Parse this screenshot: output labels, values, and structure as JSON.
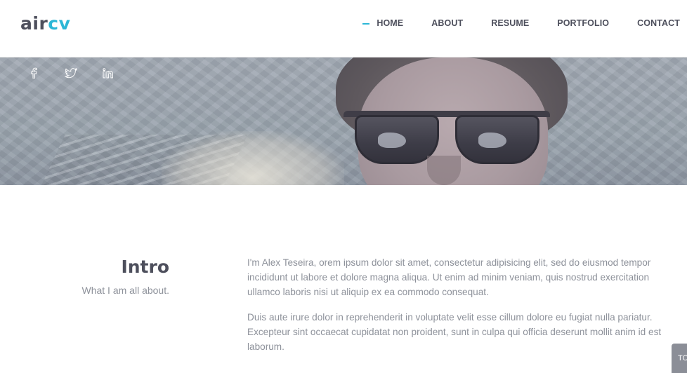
{
  "header": {
    "logo_part1": "air",
    "logo_part2": "cv",
    "brand_color": "#2cb7d6",
    "nav": [
      {
        "label": "HOME",
        "active": true
      },
      {
        "label": "ABOUT"
      },
      {
        "label": "RESUME"
      },
      {
        "label": "PORTFOLIO"
      },
      {
        "label": "CONTACT"
      }
    ]
  },
  "hero": {
    "social": [
      "facebook-icon",
      "twitter-icon",
      "linkedin-icon"
    ]
  },
  "intro": {
    "title": "Intro",
    "subtitle": "What I am all about.",
    "paragraphs": [
      "I'm Alex Teseira, orem ipsum dolor sit amet, consectetur adipisicing elit, sed do eiusmod tempor incididunt ut labore et dolore magna aliqua. Ut enim ad minim veniam, quis nostrud exercitation ullamco laboris nisi ut aliquip ex ea commodo consequat.",
      "Duis aute irure dolor in reprehenderit in voluptate velit esse cillum dolore eu fugiat nulla pariatur. Excepteur sint occaecat cupidatat non proident, sunt in culpa qui officia deserunt mollit anim id est laborum."
    ]
  },
  "to_top": {
    "label": "TO"
  }
}
